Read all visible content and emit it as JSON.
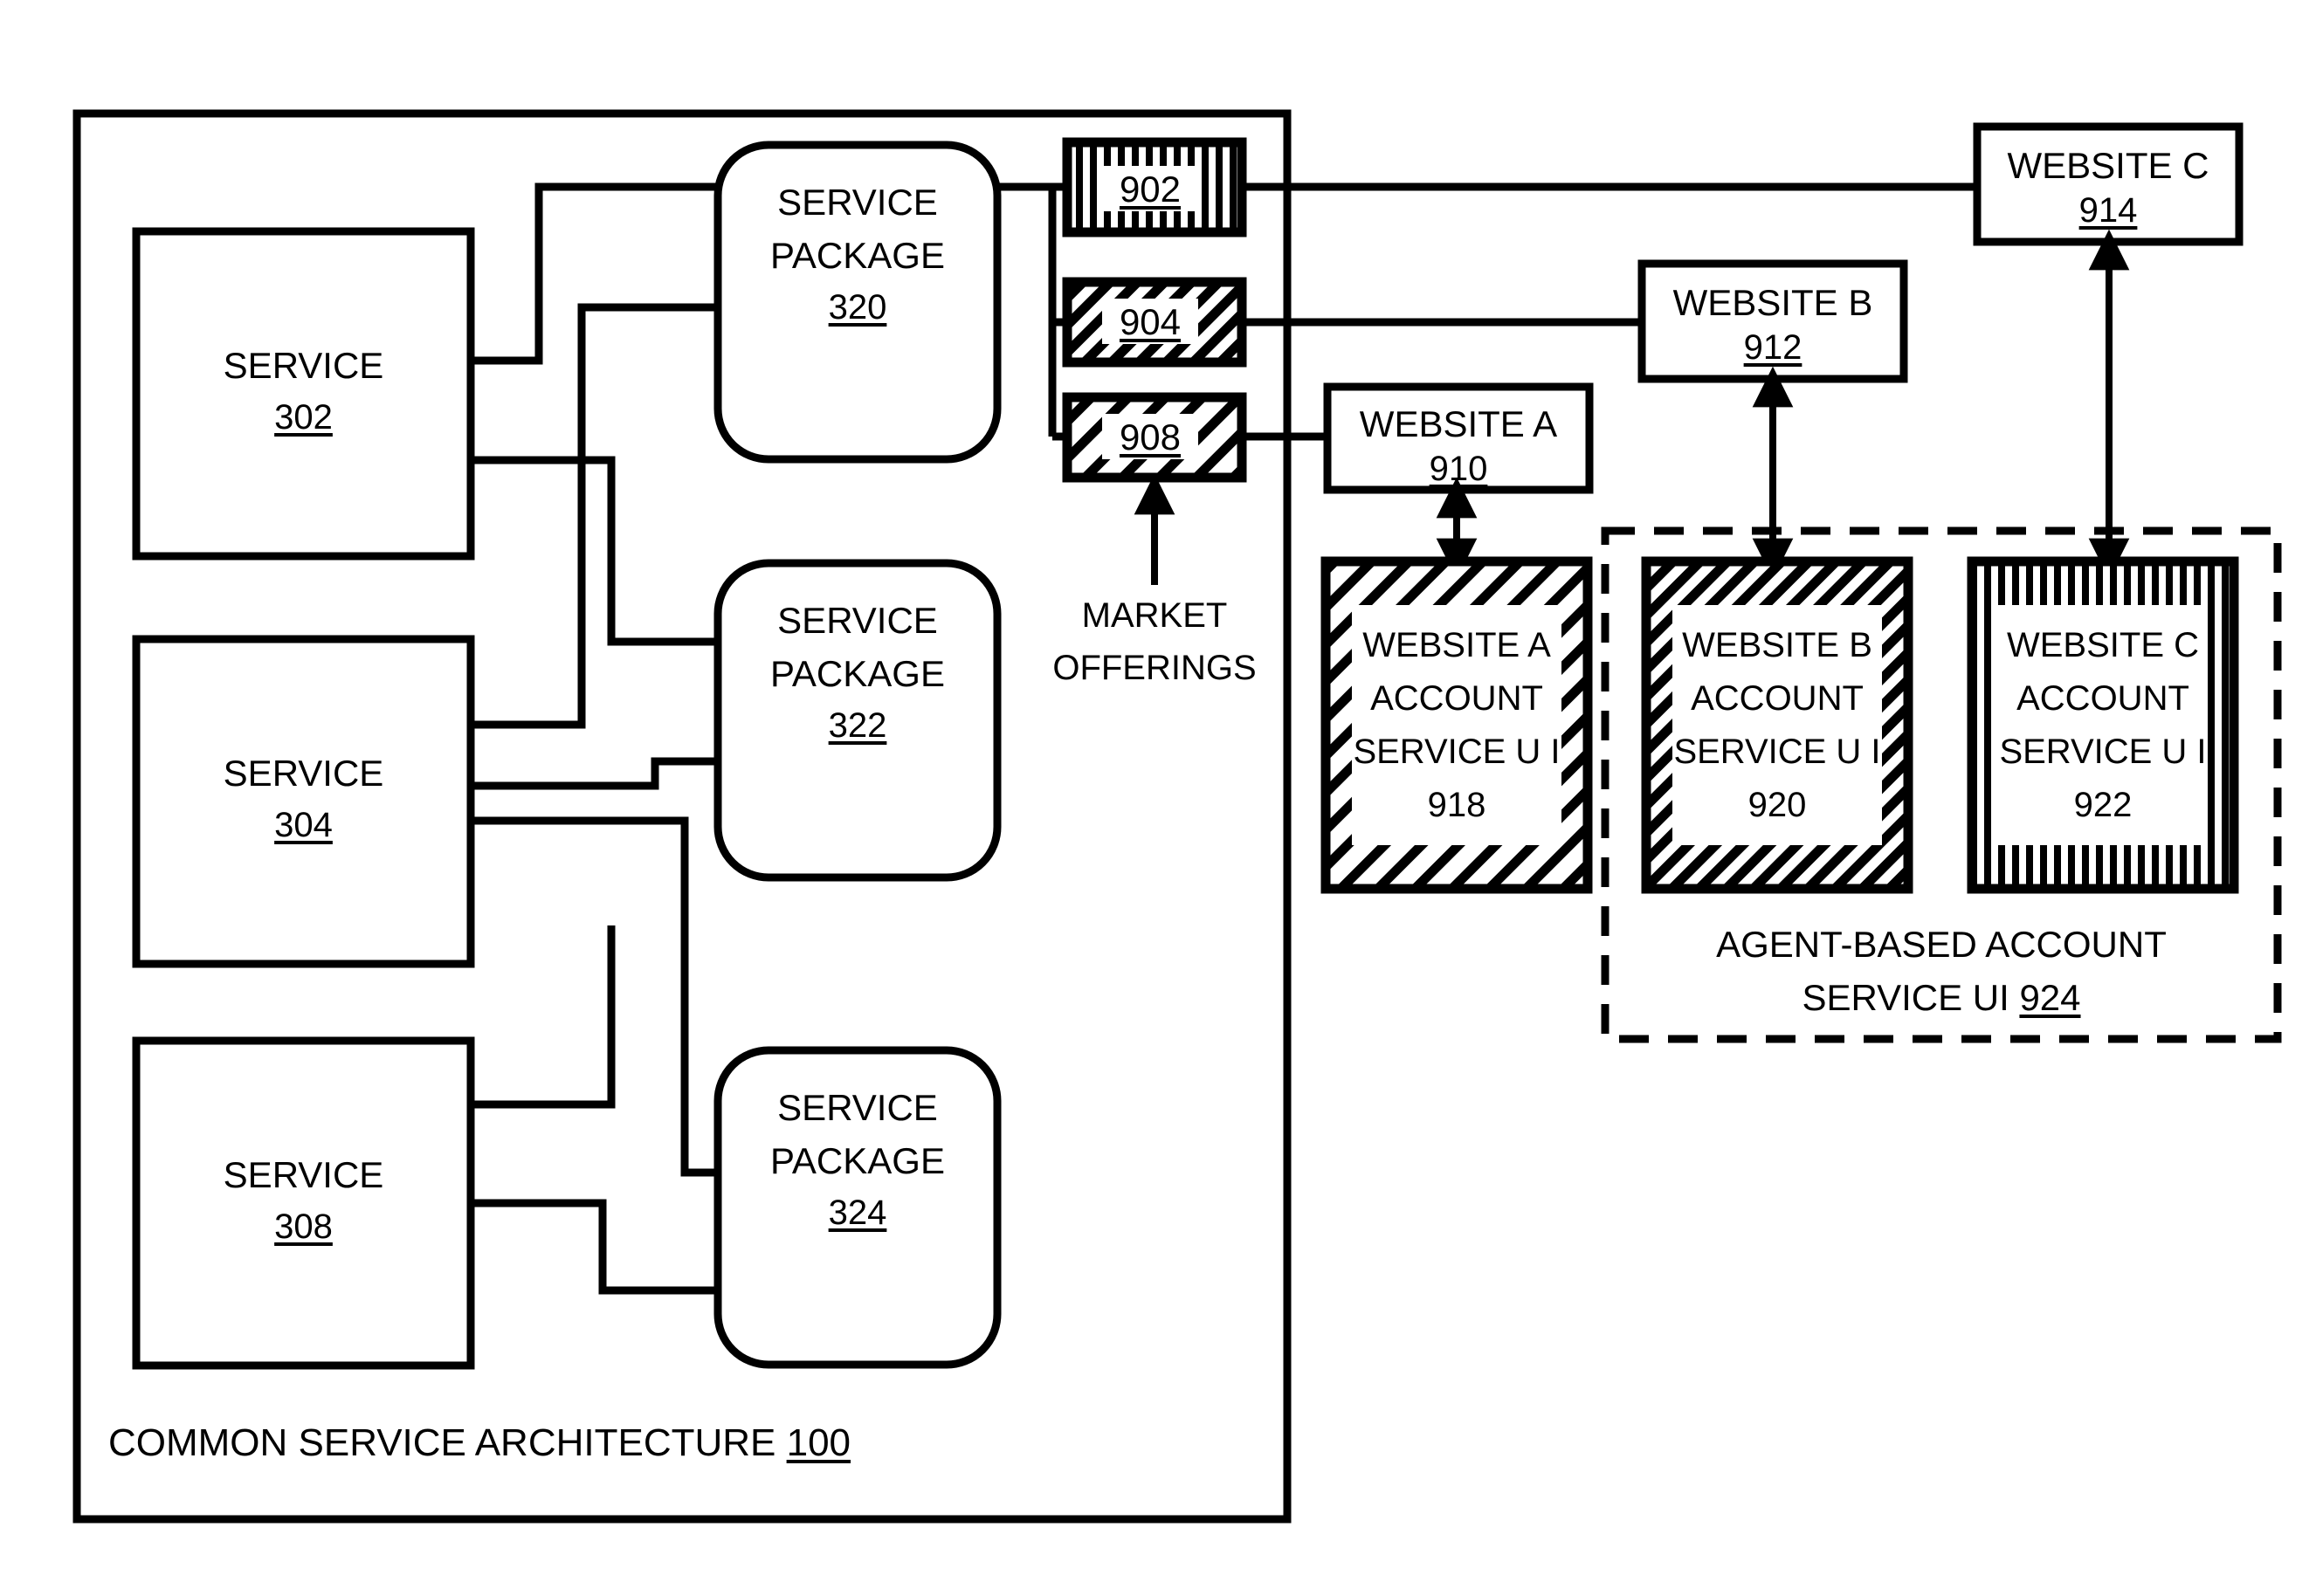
{
  "diagram": {
    "title": "Common Service Architecture",
    "figure_label": "COMMON SERVICE ARCHITECTURE 100",
    "container": {
      "label_text": "COMMON SERVICE ARCHITECTURE",
      "label_number": "100"
    },
    "services": [
      {
        "name": "SERVICE",
        "number": "302"
      },
      {
        "name": "SERVICE",
        "number": "304"
      },
      {
        "name": "SERVICE",
        "number": "308"
      }
    ],
    "service_packages": [
      {
        "line1": "SERVICE",
        "line2": "PACKAGE",
        "number": "320"
      },
      {
        "line1": "SERVICE",
        "line2": "PACKAGE",
        "number": "322"
      },
      {
        "line1": "SERVICE",
        "line2": "PACKAGE",
        "number": "324"
      }
    ],
    "market_offerings": {
      "callout_line1": "MARKET",
      "callout_line2": "OFFERINGS",
      "items": [
        {
          "number": "902",
          "fill": "vertical-stripes"
        },
        {
          "number": "904",
          "fill": "diagonal-hatch-dense"
        },
        {
          "number": "908",
          "fill": "diagonal-hatch-sparse"
        }
      ]
    },
    "websites": [
      {
        "label": "WEBSITE A",
        "number": "910"
      },
      {
        "label": "WEBSITE B",
        "number": "912"
      },
      {
        "label": "WEBSITE C",
        "number": "914"
      }
    ],
    "account_service_uis": [
      {
        "line1": "WEBSITE A",
        "line2": "ACCOUNT",
        "line3": "SERVICE U I",
        "number": "918",
        "fill": "diagonal-hatch-sparse"
      },
      {
        "line1": "WEBSITE B",
        "line2": "ACCOUNT",
        "line3": "SERVICE U I",
        "number": "920",
        "fill": "diagonal-hatch-dense"
      },
      {
        "line1": "WEBSITE C",
        "line2": "ACCOUNT",
        "line3": "SERVICE U I",
        "number": "922",
        "fill": "vertical-stripes"
      }
    ],
    "agent_group": {
      "line1": "AGENT-BASED ACCOUNT",
      "line2_text": "SERVICE UI",
      "line2_number": "924"
    },
    "colors": {
      "stroke": "#000000",
      "background": "#ffffff"
    }
  }
}
